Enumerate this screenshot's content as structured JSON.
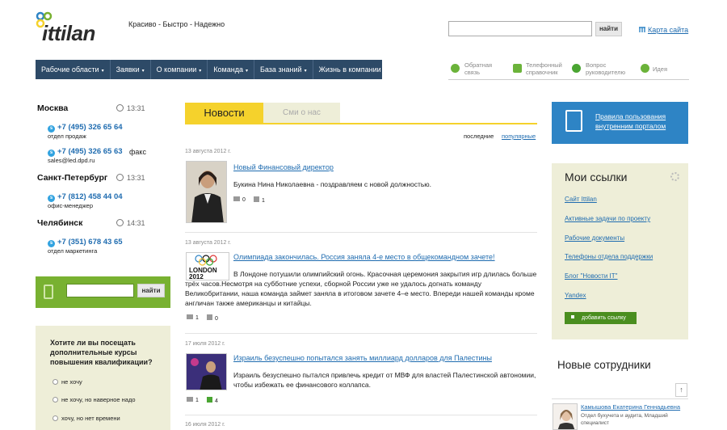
{
  "header": {
    "logo_text": "ittilan",
    "tagline": "Красиво - Быстро - Надежно",
    "search_button": "найти",
    "sitemap": "Карта сайта"
  },
  "nav": [
    {
      "label": "Рабочие области",
      "caret": "▾"
    },
    {
      "label": "Заявки",
      "caret": "▾"
    },
    {
      "label": "О компании",
      "caret": "▾"
    },
    {
      "label": "Команда",
      "caret": "▾"
    },
    {
      "label": "База знаний",
      "caret": "▾"
    },
    {
      "label": "Жизнь в компании",
      "caret": "▾"
    }
  ],
  "quick_links": [
    {
      "line1": "Обратная",
      "line2": "связь",
      "icon": "feedback-icon",
      "color": "#6bb33a"
    },
    {
      "line1": "Телефонный",
      "line2": "справочник",
      "icon": "phonebook-icon",
      "color": "#6bb33a"
    },
    {
      "line1": "Вопрос",
      "line2": "руководителю",
      "icon": "question-icon",
      "color": "#4aa532"
    },
    {
      "line1": "Идея",
      "line2": "",
      "icon": "idea-icon",
      "color": "#6bb33a"
    }
  ],
  "contacts": [
    {
      "city": "Москва",
      "time": "13:31",
      "phones": [
        {
          "number": "+7 (495) 326 65 64",
          "note": "отдел продаж"
        },
        {
          "number": "+7 (495) 326 65 63",
          "note": "sales@led.dpd.ru",
          "extra": "факс"
        }
      ]
    },
    {
      "city": "Санкт-Петербург",
      "time": "13:31",
      "phones": [
        {
          "number": "+7 (812) 458 44 04",
          "note": "офис-менеджер"
        }
      ]
    },
    {
      "city": "Челябинск",
      "time": "14:31",
      "phones": [
        {
          "number": "+7 (351) 678 43 65",
          "note": "отдел маркетинга"
        }
      ]
    }
  ],
  "left_search": {
    "button": "найти"
  },
  "poll": {
    "question": "Хотите ли вы посещать дополнительные курсы повышения квалификации?",
    "options": [
      "не хочу",
      "не хочу, но наверное надо",
      "хочу, но нет времени"
    ]
  },
  "tabs": {
    "news": "Новости",
    "smi": "Сми о нас"
  },
  "sort": {
    "latest": "последние",
    "popular": "популярные"
  },
  "news": [
    {
      "date": "13 августа 2012 г.",
      "title": "Новый Финансовый директор",
      "text": "Букина Нина Николаевна - поздравляем с новой должностью.",
      "comments": "0",
      "likes": "1"
    },
    {
      "date": "13 августа 2012 г.",
      "title": "Олимпиада закончилась. Россия заняла 4-е место в общекомандном зачете!",
      "text": "В Лондоне потушили олимпийский огонь. Красочная церемония закрытия игр длилась больше трёх часов.Несмотря на субботние успехи, сборной России уже не удалось догнать команду Великобритании, наша команда займет заняла в итоговом зачете 4–е место. Впереди нашей команды кроме англичан также американцы и китайцы.",
      "comments": "1",
      "likes": "0",
      "thumb_text": "LONDON 2012"
    },
    {
      "date": "17 июля 2012 г.",
      "title": "Израиль безуспешно попытался занять миллиард долларов для Палестины",
      "text": "Израиль безуспешно пытался привлечь кредит от МВФ для властей Палестинской автономии, чтобы избежать ее финансового коллапса.",
      "comments": "1",
      "likes": "4"
    },
    {
      "date": "16 июля 2012 г."
    }
  ],
  "right": {
    "rules": "Правила пользования внутренним порталом",
    "links_title": "Мои ссылки",
    "links": [
      "Сайт Ittilan",
      "Активные задачи по проекту",
      "Рабочие документы",
      "Телефоны отдела поддержки",
      "Блог \"Новости IT\"",
      "Yandex"
    ],
    "add_link": "добавить ссылку",
    "new_employees_title": "Новые сотрудники",
    "up_arrow": "↑",
    "employee": {
      "name": "Камышова Екатерина Геннадьевна",
      "position": "Отдел бухучета и аудита, Младший специалист"
    }
  },
  "colors": {
    "nav_bg": "#2d4a67",
    "news_tab": "#f5d22c",
    "green": "#78b131",
    "blue_box": "#2e84c5",
    "beige": "#eeeed8"
  }
}
